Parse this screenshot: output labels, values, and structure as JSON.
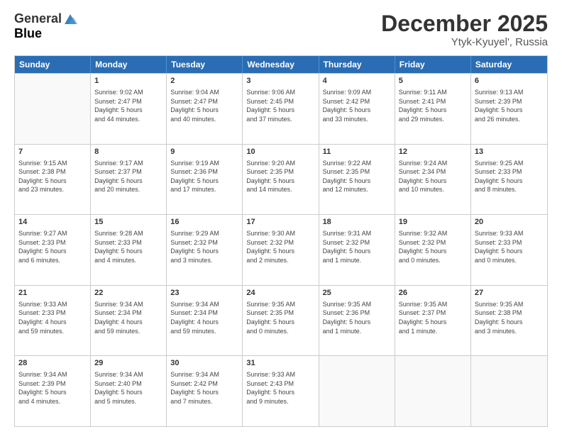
{
  "header": {
    "logo_general": "General",
    "logo_blue": "Blue",
    "month": "December 2025",
    "location": "Ytyk-Kyuyel', Russia"
  },
  "days_of_week": [
    "Sunday",
    "Monday",
    "Tuesday",
    "Wednesday",
    "Thursday",
    "Friday",
    "Saturday"
  ],
  "rows": [
    [
      {
        "day": "",
        "lines": []
      },
      {
        "day": "1",
        "lines": [
          "Sunrise: 9:02 AM",
          "Sunset: 2:47 PM",
          "Daylight: 5 hours",
          "and 44 minutes."
        ]
      },
      {
        "day": "2",
        "lines": [
          "Sunrise: 9:04 AM",
          "Sunset: 2:47 PM",
          "Daylight: 5 hours",
          "and 40 minutes."
        ]
      },
      {
        "day": "3",
        "lines": [
          "Sunrise: 9:06 AM",
          "Sunset: 2:45 PM",
          "Daylight: 5 hours",
          "and 37 minutes."
        ]
      },
      {
        "day": "4",
        "lines": [
          "Sunrise: 9:09 AM",
          "Sunset: 2:42 PM",
          "Daylight: 5 hours",
          "and 33 minutes."
        ]
      },
      {
        "day": "5",
        "lines": [
          "Sunrise: 9:11 AM",
          "Sunset: 2:41 PM",
          "Daylight: 5 hours",
          "and 29 minutes."
        ]
      },
      {
        "day": "6",
        "lines": [
          "Sunrise: 9:13 AM",
          "Sunset: 2:39 PM",
          "Daylight: 5 hours",
          "and 26 minutes."
        ]
      }
    ],
    [
      {
        "day": "7",
        "lines": [
          "Sunrise: 9:15 AM",
          "Sunset: 2:38 PM",
          "Daylight: 5 hours",
          "and 23 minutes."
        ]
      },
      {
        "day": "8",
        "lines": [
          "Sunrise: 9:17 AM",
          "Sunset: 2:37 PM",
          "Daylight: 5 hours",
          "and 20 minutes."
        ]
      },
      {
        "day": "9",
        "lines": [
          "Sunrise: 9:19 AM",
          "Sunset: 2:36 PM",
          "Daylight: 5 hours",
          "and 17 minutes."
        ]
      },
      {
        "day": "10",
        "lines": [
          "Sunrise: 9:20 AM",
          "Sunset: 2:35 PM",
          "Daylight: 5 hours",
          "and 14 minutes."
        ]
      },
      {
        "day": "11",
        "lines": [
          "Sunrise: 9:22 AM",
          "Sunset: 2:35 PM",
          "Daylight: 5 hours",
          "and 12 minutes."
        ]
      },
      {
        "day": "12",
        "lines": [
          "Sunrise: 9:24 AM",
          "Sunset: 2:34 PM",
          "Daylight: 5 hours",
          "and 10 minutes."
        ]
      },
      {
        "day": "13",
        "lines": [
          "Sunrise: 9:25 AM",
          "Sunset: 2:33 PM",
          "Daylight: 5 hours",
          "and 8 minutes."
        ]
      }
    ],
    [
      {
        "day": "14",
        "lines": [
          "Sunrise: 9:27 AM",
          "Sunset: 2:33 PM",
          "Daylight: 5 hours",
          "and 6 minutes."
        ]
      },
      {
        "day": "15",
        "lines": [
          "Sunrise: 9:28 AM",
          "Sunset: 2:33 PM",
          "Daylight: 5 hours",
          "and 4 minutes."
        ]
      },
      {
        "day": "16",
        "lines": [
          "Sunrise: 9:29 AM",
          "Sunset: 2:32 PM",
          "Daylight: 5 hours",
          "and 3 minutes."
        ]
      },
      {
        "day": "17",
        "lines": [
          "Sunrise: 9:30 AM",
          "Sunset: 2:32 PM",
          "Daylight: 5 hours",
          "and 2 minutes."
        ]
      },
      {
        "day": "18",
        "lines": [
          "Sunrise: 9:31 AM",
          "Sunset: 2:32 PM",
          "Daylight: 5 hours",
          "and 1 minute."
        ]
      },
      {
        "day": "19",
        "lines": [
          "Sunrise: 9:32 AM",
          "Sunset: 2:32 PM",
          "Daylight: 5 hours",
          "and 0 minutes."
        ]
      },
      {
        "day": "20",
        "lines": [
          "Sunrise: 9:33 AM",
          "Sunset: 2:33 PM",
          "Daylight: 5 hours",
          "and 0 minutes."
        ]
      }
    ],
    [
      {
        "day": "21",
        "lines": [
          "Sunrise: 9:33 AM",
          "Sunset: 2:33 PM",
          "Daylight: 4 hours",
          "and 59 minutes."
        ]
      },
      {
        "day": "22",
        "lines": [
          "Sunrise: 9:34 AM",
          "Sunset: 2:34 PM",
          "Daylight: 4 hours",
          "and 59 minutes."
        ]
      },
      {
        "day": "23",
        "lines": [
          "Sunrise: 9:34 AM",
          "Sunset: 2:34 PM",
          "Daylight: 4 hours",
          "and 59 minutes."
        ]
      },
      {
        "day": "24",
        "lines": [
          "Sunrise: 9:35 AM",
          "Sunset: 2:35 PM",
          "Daylight: 5 hours",
          "and 0 minutes."
        ]
      },
      {
        "day": "25",
        "lines": [
          "Sunrise: 9:35 AM",
          "Sunset: 2:36 PM",
          "Daylight: 5 hours",
          "and 1 minute."
        ]
      },
      {
        "day": "26",
        "lines": [
          "Sunrise: 9:35 AM",
          "Sunset: 2:37 PM",
          "Daylight: 5 hours",
          "and 1 minute."
        ]
      },
      {
        "day": "27",
        "lines": [
          "Sunrise: 9:35 AM",
          "Sunset: 2:38 PM",
          "Daylight: 5 hours",
          "and 3 minutes."
        ]
      }
    ],
    [
      {
        "day": "28",
        "lines": [
          "Sunrise: 9:34 AM",
          "Sunset: 2:39 PM",
          "Daylight: 5 hours",
          "and 4 minutes."
        ]
      },
      {
        "day": "29",
        "lines": [
          "Sunrise: 9:34 AM",
          "Sunset: 2:40 PM",
          "Daylight: 5 hours",
          "and 5 minutes."
        ]
      },
      {
        "day": "30",
        "lines": [
          "Sunrise: 9:34 AM",
          "Sunset: 2:42 PM",
          "Daylight: 5 hours",
          "and 7 minutes."
        ]
      },
      {
        "day": "31",
        "lines": [
          "Sunrise: 9:33 AM",
          "Sunset: 2:43 PM",
          "Daylight: 5 hours",
          "and 9 minutes."
        ]
      },
      {
        "day": "",
        "lines": []
      },
      {
        "day": "",
        "lines": []
      },
      {
        "day": "",
        "lines": []
      }
    ]
  ]
}
